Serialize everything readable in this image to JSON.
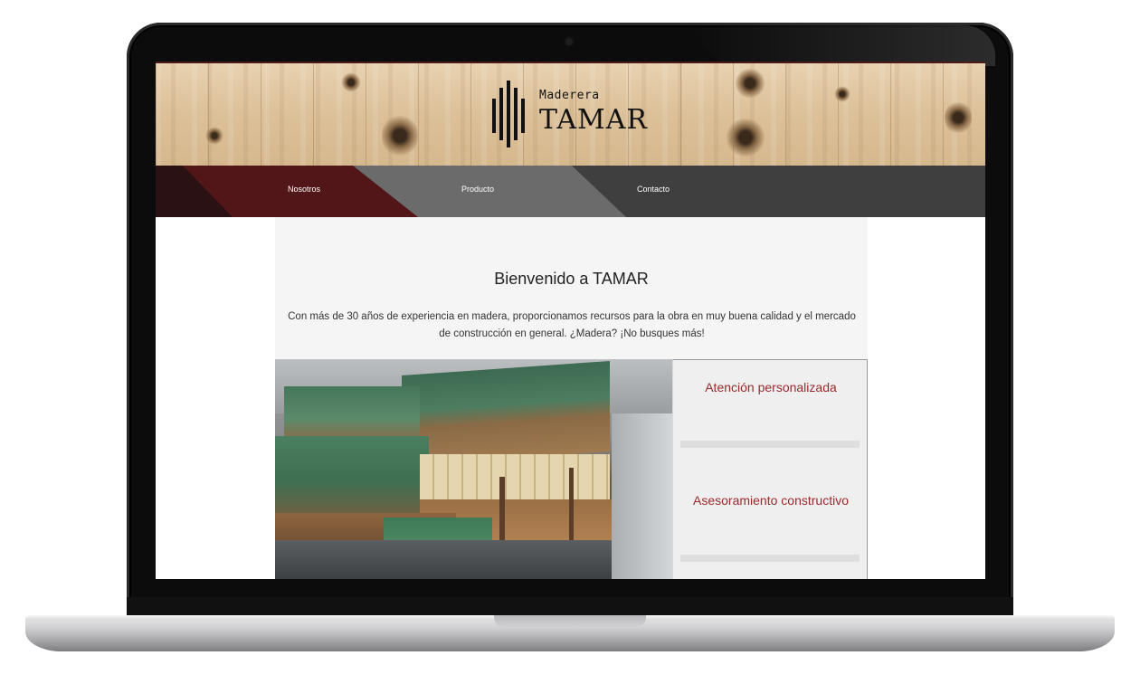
{
  "site": {
    "logo": {
      "small": "Maderera",
      "big": "TAMAR"
    },
    "nav": {
      "items": [
        "Nosotros",
        "Producto",
        "Contacto"
      ]
    },
    "welcome": {
      "title": "Bienvenido a TAMAR",
      "text": "Con más de 30 años de experiencia en madera, proporcionamos recursos para la obra en muy buena calidad y el mercado de construcción en general. ¿Madera? ¡No busques más!"
    },
    "features": [
      "Atención personalizada",
      "Asesoramiento constructivo"
    ]
  },
  "colors": {
    "brand_red": "#521618",
    "feature_text": "#9b2a2c",
    "nav_grey": "#3f3f3f"
  }
}
